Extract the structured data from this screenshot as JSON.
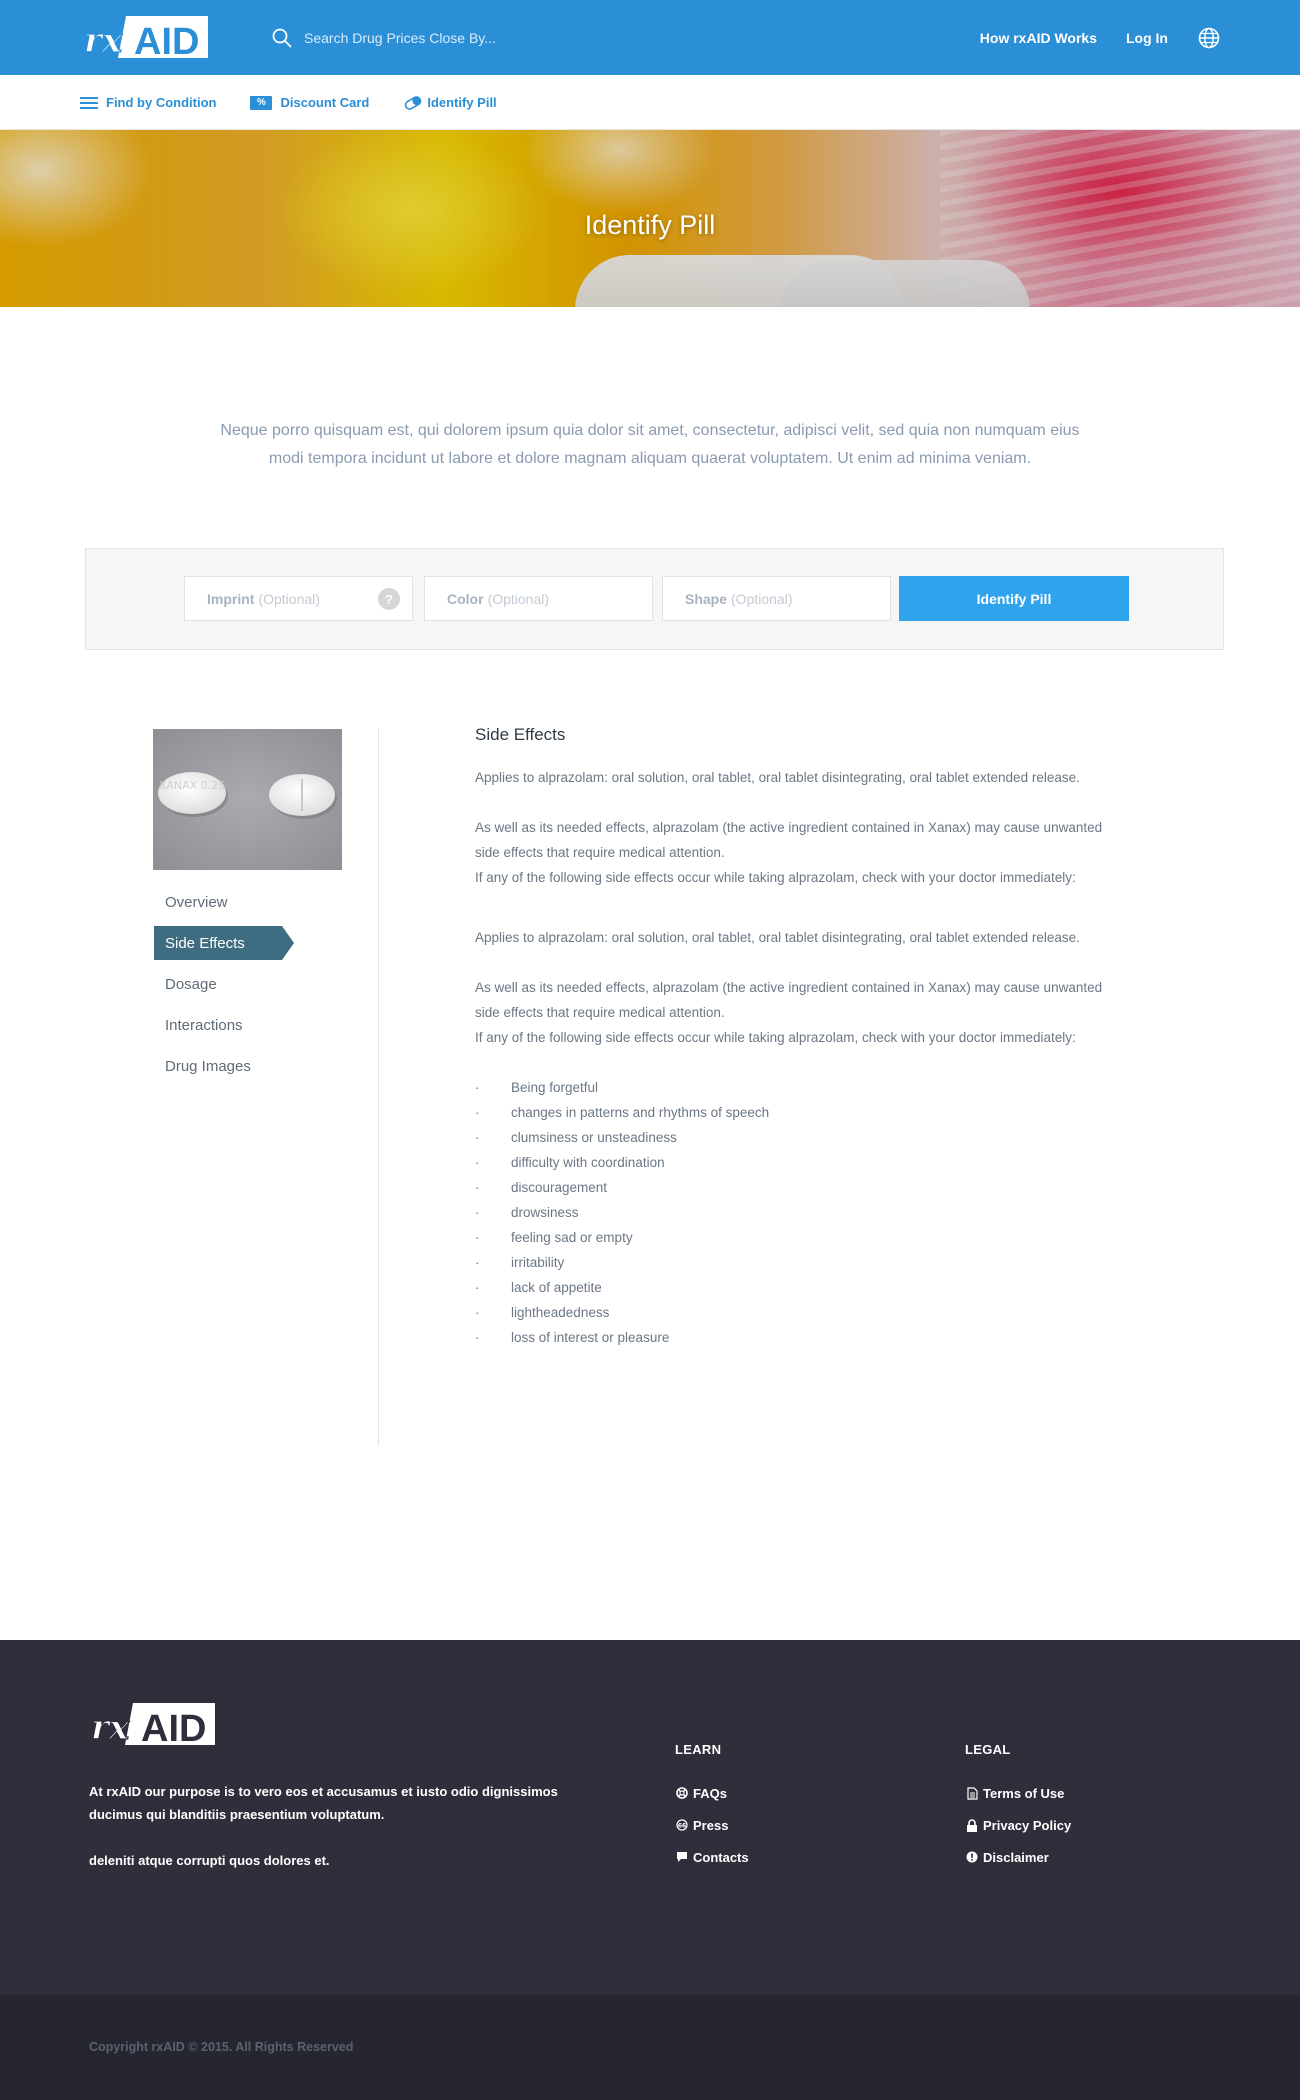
{
  "header": {
    "logo_text": "rxAID",
    "search_placeholder": "Search Drug Prices Close By...",
    "nav": [
      "How rxAID Works",
      "Log In"
    ]
  },
  "subnav": {
    "items": [
      {
        "label": "Find by Condition",
        "icon": "menu-lines-icon"
      },
      {
        "label": "Discount Card",
        "icon": "percent-badge-icon",
        "badge": "%"
      },
      {
        "label": "Identify Pill",
        "icon": "pill-icon"
      }
    ]
  },
  "hero": {
    "title": "Identify Pill"
  },
  "intro": "Neque porro quisquam est, qui dolorem ipsum quia dolor sit amet, consectetur, adipisci velit, sed quia non numquam eius modi tempora incidunt ut labore et dolore magnam aliquam quaerat voluptatem. Ut enim ad minima veniam.",
  "identify_form": {
    "imprint_label": "Imprint",
    "color_label": "Color",
    "shape_label": "Shape",
    "optional": "(Optional)",
    "help": "?",
    "button": "Identify Pill"
  },
  "sidebar": {
    "pill_imprint": "XANAX 0.25",
    "items": [
      {
        "label": "Overview",
        "active": false
      },
      {
        "label": "Side Effects",
        "active": true
      },
      {
        "label": "Dosage",
        "active": false
      },
      {
        "label": "Interactions",
        "active": false
      },
      {
        "label": "Drug Images",
        "active": false
      }
    ]
  },
  "content": {
    "heading": "Side Effects",
    "p1": "Applies to alprazolam: oral solution, oral tablet, oral tablet disintegrating, oral tablet extended release.",
    "p2a": "As well as its needed effects, alprazolam (the active ingredient contained in Xanax) may cause unwanted side effects that require medical attention.",
    "p2b": "If any of the following side effects occur while taking alprazolam, check with your doctor immediately:",
    "p3": "Applies to alprazolam: oral solution, oral tablet, oral tablet disintegrating, oral tablet extended release.",
    "p4a": "As well as its needed effects, alprazolam (the active ingredient contained in Xanax) may cause unwanted side effects that require medical attention.",
    "p4b": "If any of the following side effects occur while taking alprazolam, check with your doctor immediately:",
    "bullets": [
      "Being forgetful",
      "changes in patterns and rhythms of speech",
      "clumsiness or unsteadiness",
      "difficulty with coordination",
      "discouragement",
      "drowsiness",
      "feeling sad or empty",
      "irritability",
      "lack of appetite",
      "lightheadedness",
      "loss of interest or pleasure"
    ]
  },
  "footer": {
    "about1": "At rxAID our purpose is to vero eos et accusamus et iusto odio dignissimos ducimus qui blanditiis praesentium voluptatum.",
    "about2": "deleniti atque corrupti quos dolores et.",
    "learn": {
      "title": "LEARN",
      "links": [
        {
          "label": "FAQs",
          "icon": "lifebuoy-icon"
        },
        {
          "label": "Press",
          "icon": "press-icon"
        },
        {
          "label": "Contacts",
          "icon": "chat-icon"
        }
      ]
    },
    "legal": {
      "title": "LEGAL",
      "links": [
        {
          "label": "Terms of Use",
          "icon": "document-icon"
        },
        {
          "label": "Privacy Policy",
          "icon": "lock-icon"
        },
        {
          "label": "Disclaimer",
          "icon": "info-icon"
        }
      ]
    },
    "copyright": "Copyright rxAID © 2015. All Rights Reserved"
  },
  "colors": {
    "brand_blue": "#2a8fd6",
    "button_blue": "#2fa3ec",
    "active_tab": "#3e6c80",
    "footer_bg": "#2f2f3b"
  }
}
